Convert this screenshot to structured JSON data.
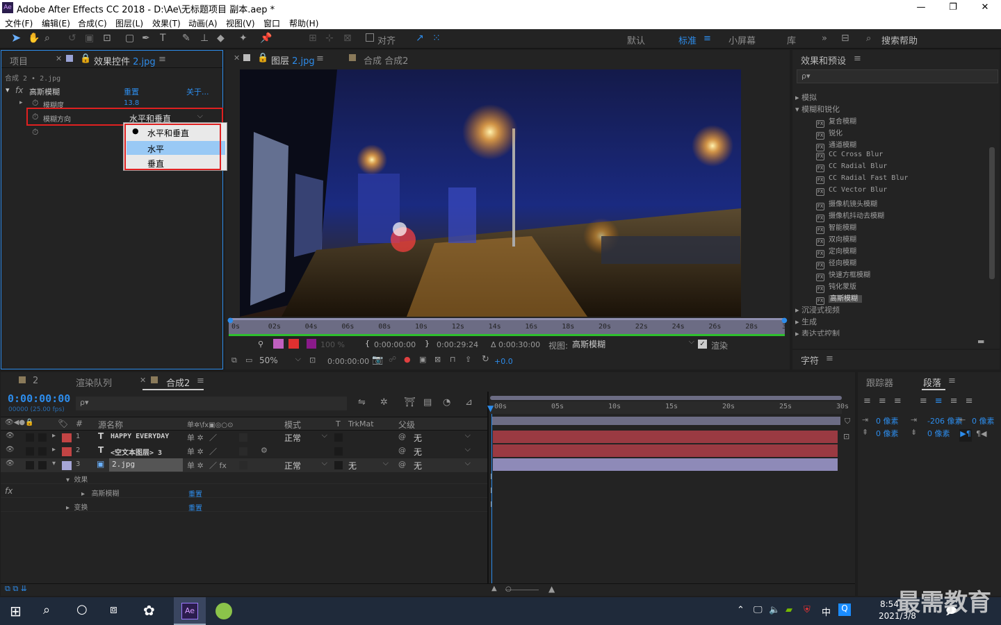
{
  "window": {
    "title": "Adobe After Effects CC 2018 - D:\\Ae\\无标题项目 副本.aep *",
    "app_icon": "Ae"
  },
  "menu": [
    "文件(F)",
    "编辑(E)",
    "合成(C)",
    "图层(L)",
    "效果(T)",
    "动画(A)",
    "视图(V)",
    "窗口",
    "帮助(H)"
  ],
  "toolbar": {
    "snap_label": "对齐",
    "workspaces": [
      "默认",
      "标准",
      "小屏幕",
      "库"
    ],
    "active_workspace": "标准",
    "search_placeholder": "搜索帮助"
  },
  "effect_controls": {
    "tab_project": "项目",
    "tab_label": "效果控件",
    "tab_file": "2.jpg",
    "breadcrumb": "合成 2 • 2.jpg",
    "effect_name": "高斯模糊",
    "reset": "重置",
    "about": "关于...",
    "prop1_label": "模糊度",
    "prop1_value": "13.8",
    "prop2_label": "模糊方向",
    "prop2_value": "水平和垂直",
    "dropdown_options": [
      "水平和垂直",
      "水平",
      "垂直"
    ],
    "selected_option": "水平和垂直",
    "highlighted_option": "水平"
  },
  "viewer": {
    "tab_layer": "图层",
    "tab_layer_file": "2.jpg",
    "tab_comp": "合成 合成2",
    "ruler_ticks": [
      "0s",
      "02s",
      "04s",
      "06s",
      "08s",
      "10s",
      "12s",
      "14s",
      "16s",
      "18s",
      "20s",
      "22s",
      "24s",
      "26s",
      "28s",
      "30s"
    ],
    "opacity": "100 %",
    "in_time": "0:00:00:00",
    "out_time": "0:00:29:24",
    "duration": "Δ 0:00:30:00",
    "view_label": "视图:",
    "view_value": "高斯模糊",
    "render_label": "渲染",
    "zoom": "50%",
    "current_time": "0:00:00:00",
    "exposure": "+0.0"
  },
  "effects_presets": {
    "title": "效果和预设",
    "search_placeholder": "ρ▾",
    "categories": [
      {
        "name": "模拟",
        "open": false
      },
      {
        "name": "模糊和锐化",
        "open": true
      }
    ],
    "items": [
      "复合模糊",
      "锐化",
      "通道模糊",
      "CC Cross Blur",
      "CC Radial Blur",
      "CC Radial Fast Blur",
      "CC Vector Blur",
      "摄像机镜头模糊",
      "摄像机抖动去模糊",
      "智能模糊",
      "双向模糊",
      "定向模糊",
      "径向模糊",
      "快速方框模糊",
      "钝化蒙版",
      "高斯模糊"
    ],
    "selected_item": "高斯模糊",
    "after": [
      "沉浸式视频",
      "生成",
      "表达式控制"
    ],
    "char_title": "字符"
  },
  "timeline": {
    "tabs": [
      "2",
      "渲染队列",
      "合成2"
    ],
    "timecode": "0:00:00:00",
    "fps": "00000 (25.00 fps)",
    "search_placeholder": "ρ▾",
    "col_source": "源名称",
    "col_mode": "模式",
    "col_t": "T",
    "col_trkmat": "TrkMat",
    "col_parent": "父级",
    "ruler": [
      "00s",
      "05s",
      "10s",
      "15s",
      "20s",
      "25s",
      "30s"
    ],
    "layers": [
      {
        "num": "1",
        "type": "T",
        "name": "HAPPY EVERYDAY",
        "mode": "正常",
        "trkmat": "",
        "parent": "无",
        "color": "#c24444"
      },
      {
        "num": "2",
        "type": "T",
        "name": "<空文本图层> 3",
        "mode": "",
        "trkmat": "",
        "parent": "无",
        "color": "#c24444"
      },
      {
        "num": "3",
        "type": "img",
        "name": "2.jpg",
        "mode": "正常",
        "trkmat": "无",
        "parent": "无",
        "color": "#a5a5d6"
      }
    ],
    "sub_effects": "效果",
    "sub_gauss": "高斯模糊",
    "sub_transform": "变换",
    "reset": "重置"
  },
  "right_bottom": {
    "tab_tracker": "跟踪器",
    "tab_paragraph": "段落",
    "indent_left": "0 像素",
    "indent_first": "-206 像素",
    "indent_right": "0 像素",
    "space_before": "0 像素",
    "space_after": "0 像素"
  },
  "taskbar": {
    "time": "8:54",
    "date": "2021/3/8",
    "ime": "中",
    "watermark": "最需教育"
  }
}
